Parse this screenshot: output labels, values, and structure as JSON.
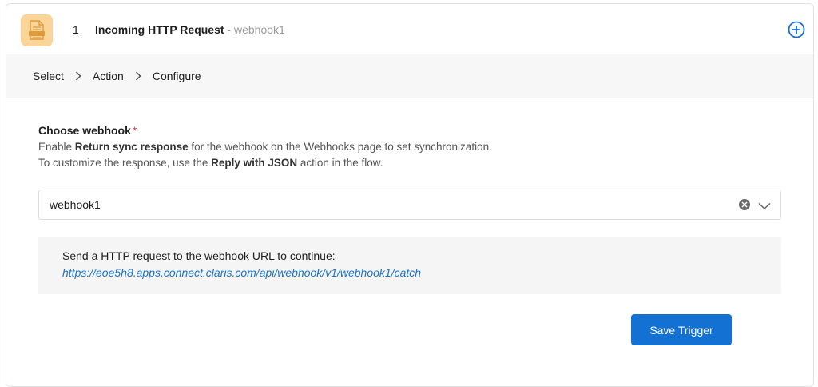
{
  "header": {
    "step_number": "1",
    "title": "Incoming HTTP Request",
    "subtitle": "- webhook1",
    "app_icon": "http-document-icon",
    "add_icon": "plus-circle-icon",
    "accent_color": "#1271d3"
  },
  "breadcrumb": {
    "items": [
      "Select",
      "Action",
      "Configure"
    ]
  },
  "form": {
    "label": "Choose webhook",
    "required_mark": "*",
    "help_line1_prefix": "Enable ",
    "help_line1_bold": "Return sync response",
    "help_line1_suffix": " for the webhook on the Webhooks page to set synchronization.",
    "help_line2_prefix": "To customize the response, use the ",
    "help_line2_bold": "Reply with JSON",
    "help_line2_suffix": " action in the flow.",
    "selected_webhook": "webhook1"
  },
  "info": {
    "message": "Send a HTTP request to the webhook URL to continue:",
    "url": "https://eoe5h8.apps.connect.claris.com/api/webhook/v1/webhook1/catch"
  },
  "actions": {
    "save_label": "Save Trigger"
  }
}
